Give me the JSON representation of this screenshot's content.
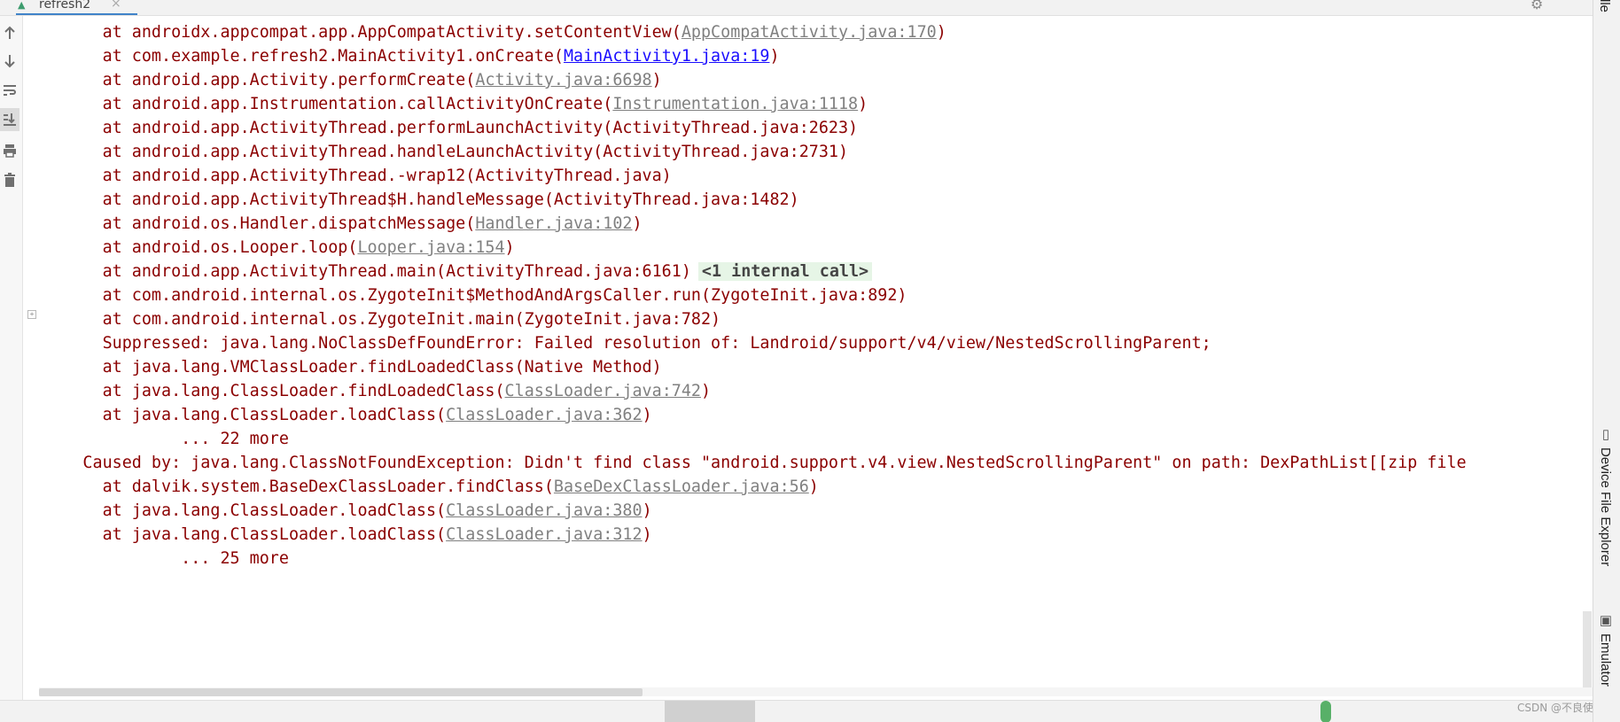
{
  "tab": {
    "label": "refresh2",
    "close": "×"
  },
  "toolbar": {
    "icons": [
      "arrow-up-icon",
      "arrow-down-icon",
      "soft-wrap-icon",
      "scroll-to-end-icon",
      "print-icon",
      "trash-icon"
    ]
  },
  "console": {
    "lines": [
      {
        "id": "l0",
        "prefix": "        at androidx.appcompat.app.AppCompatActivity.setContentView(",
        "link": "AppCompatActivity.java:170",
        "link_style": "gray",
        "suffix": ")"
      },
      {
        "id": "l1",
        "prefix": "        at com.example.refresh2.MainActivity1.onCreate(",
        "link": "MainActivity1.java:19",
        "link_style": "blue",
        "suffix": ")"
      },
      {
        "id": "l2",
        "prefix": "        at android.app.Activity.performCreate(",
        "link": "Activity.java:6698",
        "link_style": "gray",
        "suffix": ")"
      },
      {
        "id": "l3",
        "prefix": "        at android.app.Instrumentation.callActivityOnCreate(",
        "link": "Instrumentation.java:1118",
        "link_style": "gray",
        "suffix": ")"
      },
      {
        "id": "l4",
        "prefix": "        at android.app.ActivityThread.performLaunchActivity(ActivityThread.java:2623)"
      },
      {
        "id": "l5",
        "prefix": "        at android.app.ActivityThread.handleLaunchActivity(ActivityThread.java:2731)"
      },
      {
        "id": "l6",
        "prefix": "        at android.app.ActivityThread.-wrap12(ActivityThread.java)"
      },
      {
        "id": "l7",
        "prefix": "        at android.app.ActivityThread$H.handleMessage(ActivityThread.java:1482)"
      },
      {
        "id": "l8",
        "prefix": "        at android.os.Handler.dispatchMessage(",
        "link": "Handler.java:102",
        "link_style": "gray",
        "suffix": ")"
      },
      {
        "id": "l9",
        "prefix": "        at android.os.Looper.loop(",
        "link": "Looper.java:154",
        "link_style": "gray",
        "suffix": ")"
      },
      {
        "id": "l10",
        "prefix": "        at android.app.ActivityThread.main(ActivityThread.java:6161)",
        "hint": "<1 internal call>"
      },
      {
        "id": "l11",
        "prefix": "        at com.android.internal.os.ZygoteInit$MethodAndArgsCaller.run(ZygoteInit.java:892)"
      },
      {
        "id": "l12",
        "prefix": "        at com.android.internal.os.ZygoteInit.main(ZygoteInit.java:782)"
      },
      {
        "id": "l13",
        "prefix": "        Suppressed: java.lang.NoClassDefFoundError: Failed resolution of: Landroid/support/v4/view/NestedScrollingParent;"
      },
      {
        "id": "l14",
        "prefix": "        at java.lang.VMClassLoader.findLoadedClass(Native Method)"
      },
      {
        "id": "l15",
        "prefix": "        at java.lang.ClassLoader.findLoadedClass(",
        "link": "ClassLoader.java:742",
        "link_style": "gray",
        "suffix": ")"
      },
      {
        "id": "l16",
        "prefix": "        at java.lang.ClassLoader.loadClass(",
        "link": "ClassLoader.java:362",
        "link_style": "gray",
        "suffix": ")"
      },
      {
        "id": "l17",
        "prefix": "                ... 22 more"
      },
      {
        "id": "l18",
        "prefix": "      Caused by: java.lang.ClassNotFoundException: Didn't find class \"android.support.v4.view.NestedScrollingParent\" on path: DexPathList[[zip file"
      },
      {
        "id": "l19",
        "prefix": "        at dalvik.system.BaseDexClassLoader.findClass(",
        "link": "BaseDexClassLoader.java:56",
        "link_style": "gray",
        "suffix": ")"
      },
      {
        "id": "l20",
        "prefix": "        at java.lang.ClassLoader.loadClass(",
        "link": "ClassLoader.java:380",
        "link_style": "gray",
        "suffix": ")"
      },
      {
        "id": "l21",
        "prefix": "        at java.lang.ClassLoader.loadClass(",
        "link": "ClassLoader.java:312",
        "link_style": "gray",
        "suffix": ")"
      },
      {
        "id": "l22",
        "prefix": "                ... 25 more"
      }
    ]
  },
  "right_strip": {
    "gradle_label": "dle",
    "device_file_explorer_label": "Device File Explorer",
    "emulator_label": "Emulator"
  },
  "watermark": "CSDN @不良使",
  "colors": {
    "error_text": "#8b0000",
    "link_gray": "#808080",
    "link_blue": "#1a0dff",
    "hint_bg": "#e6f5e6",
    "tab_accent": "#4083c9"
  }
}
